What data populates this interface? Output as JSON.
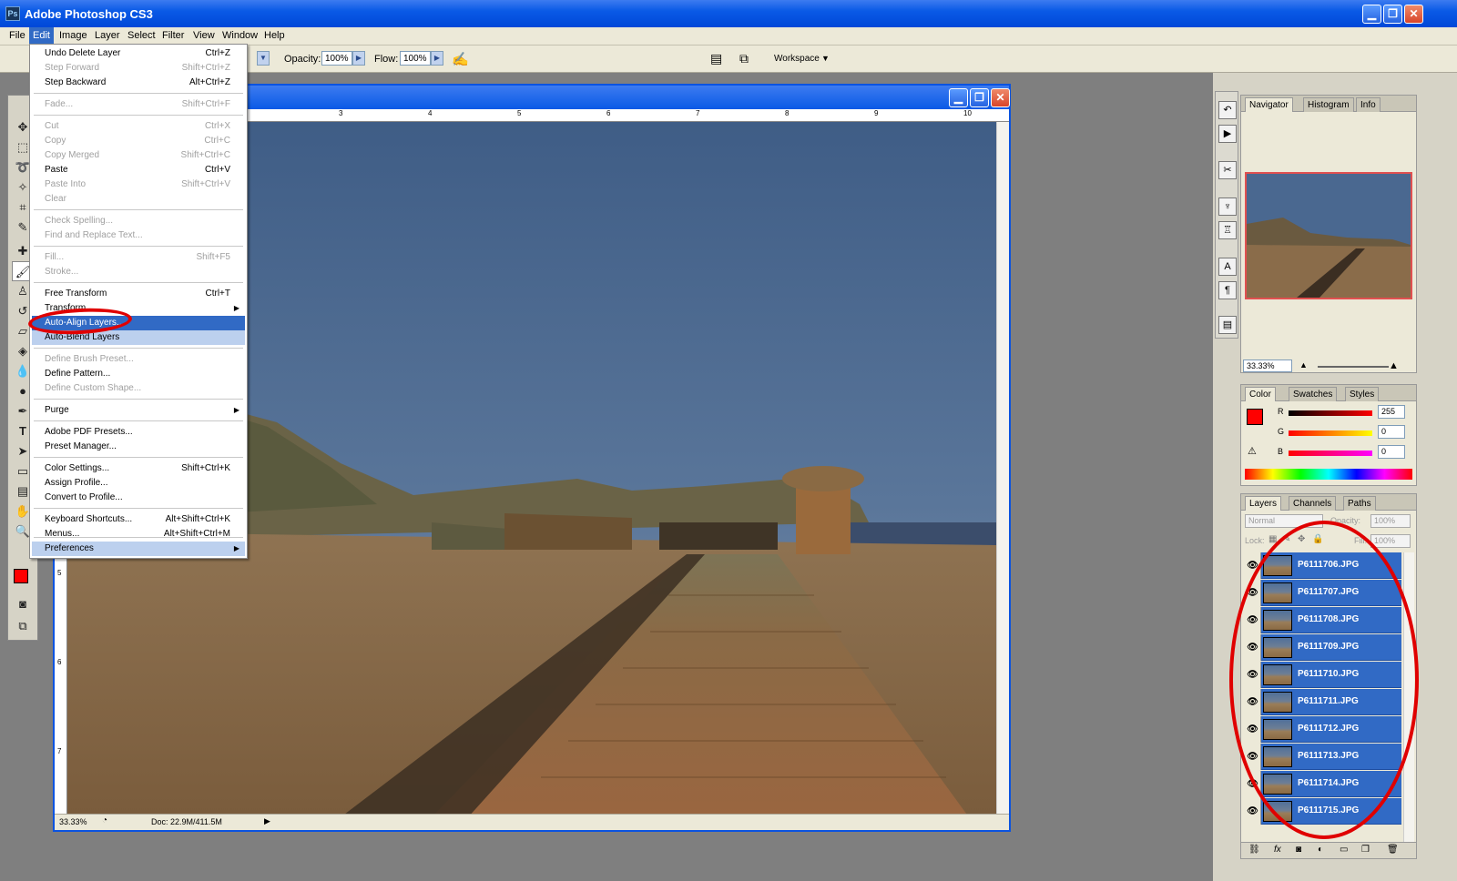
{
  "app": {
    "title": "Adobe Photoshop CS3",
    "icon_label": "Ps"
  },
  "menubar": [
    "File",
    "Edit",
    "Image",
    "Layer",
    "Select",
    "Filter",
    "View",
    "Window",
    "Help"
  ],
  "options": {
    "opacity_label": "Opacity:",
    "opacity_value": "100%",
    "flow_label": "Flow:",
    "flow_value": "100%",
    "workspace_label": "Workspace"
  },
  "edit_menu": {
    "items": [
      {
        "label": "Undo Delete Layer",
        "shortcut": "Ctrl+Z",
        "enabled": true
      },
      {
        "label": "Step Forward",
        "shortcut": "Shift+Ctrl+Z",
        "enabled": false
      },
      {
        "label": "Step Backward",
        "shortcut": "Alt+Ctrl+Z",
        "enabled": true
      },
      {
        "label": "Fade...",
        "shortcut": "Shift+Ctrl+F",
        "enabled": false
      },
      {
        "label": "Cut",
        "shortcut": "Ctrl+X",
        "enabled": false
      },
      {
        "label": "Copy",
        "shortcut": "Ctrl+C",
        "enabled": false
      },
      {
        "label": "Copy Merged",
        "shortcut": "Shift+Ctrl+C",
        "enabled": false
      },
      {
        "label": "Paste",
        "shortcut": "Ctrl+V",
        "enabled": true
      },
      {
        "label": "Paste Into",
        "shortcut": "Shift+Ctrl+V",
        "enabled": false
      },
      {
        "label": "Clear",
        "shortcut": "",
        "enabled": false
      },
      {
        "label": "Check Spelling...",
        "shortcut": "",
        "enabled": false
      },
      {
        "label": "Find and Replace Text...",
        "shortcut": "",
        "enabled": false
      },
      {
        "label": "Fill...",
        "shortcut": "Shift+F5",
        "enabled": false
      },
      {
        "label": "Stroke...",
        "shortcut": "",
        "enabled": false
      },
      {
        "label": "Free Transform",
        "shortcut": "Ctrl+T",
        "enabled": true
      },
      {
        "label": "Transform",
        "shortcut": "",
        "enabled": true
      },
      {
        "label": "Auto-Align Layers...",
        "shortcut": "",
        "enabled": true
      },
      {
        "label": "Auto-Blend Layers",
        "shortcut": "",
        "enabled": true
      },
      {
        "label": "Define Brush Preset...",
        "shortcut": "",
        "enabled": false
      },
      {
        "label": "Define Pattern...",
        "shortcut": "",
        "enabled": true
      },
      {
        "label": "Define Custom Shape...",
        "shortcut": "",
        "enabled": false
      },
      {
        "label": "Purge",
        "shortcut": "",
        "enabled": true
      },
      {
        "label": "Adobe PDF Presets...",
        "shortcut": "",
        "enabled": true
      },
      {
        "label": "Preset Manager...",
        "shortcut": "",
        "enabled": true
      },
      {
        "label": "Color Settings...",
        "shortcut": "Shift+Ctrl+K",
        "enabled": true
      },
      {
        "label": "Assign Profile...",
        "shortcut": "",
        "enabled": true
      },
      {
        "label": "Convert to Profile...",
        "shortcut": "",
        "enabled": true
      },
      {
        "label": "Keyboard Shortcuts...",
        "shortcut": "Alt+Shift+Ctrl+K",
        "enabled": true
      },
      {
        "label": "Menus...",
        "shortcut": "Alt+Shift+Ctrl+M",
        "enabled": true
      },
      {
        "label": "Preferences",
        "shortcut": "",
        "enabled": true
      }
    ]
  },
  "document": {
    "ruler_top": [
      "3",
      "4",
      "5",
      "6",
      "7",
      "8",
      "9",
      "10"
    ],
    "ruler_left": [
      "5",
      "6",
      "7"
    ],
    "zoom": "33.33%",
    "doc_info": "Doc: 22.9M/411.5M"
  },
  "navigator": {
    "tabs": [
      "Navigator",
      "Histogram",
      "Info"
    ],
    "zoom": "33.33%"
  },
  "color_panel": {
    "tabs": [
      "Color",
      "Swatches",
      "Styles"
    ],
    "r_label": "R",
    "g_label": "G",
    "b_label": "B",
    "r": "255",
    "g": "0",
    "b": "0",
    "fg_color": "#ff0000"
  },
  "layers_panel": {
    "tabs": [
      "Layers",
      "Channels",
      "Paths"
    ],
    "blend_mode": "Normal",
    "opacity_label": "Opacity:",
    "opacity": "100%",
    "lock_label": "Lock:",
    "fill_label": "Fill:",
    "fill": "100%",
    "layers": [
      "P6111706.JPG",
      "P6111707.JPG",
      "P6111708.JPG",
      "P6111709.JPG",
      "P6111710.JPG",
      "P6111711.JPG",
      "P6111712.JPG",
      "P6111713.JPG",
      "P6111714.JPG",
      "P6111715.JPG"
    ]
  }
}
